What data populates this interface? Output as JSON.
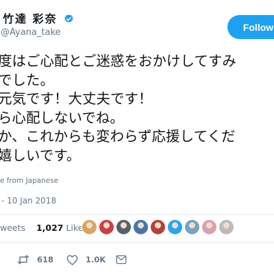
{
  "header": {
    "display_name": "竹達 彩奈",
    "handle": "@Ayana_take",
    "verified": true,
    "follow_label": "Following"
  },
  "tweet": {
    "lines": [
      "度はご心配とご迷惑をおかけしてすみ",
      "でした。",
      "元気です！大丈夫です！",
      "ら心配しないでね。",
      "か、これからも変わらず応援してくだ",
      "嬉しいです。"
    ],
    "translate_label": "e from Japanese",
    "timestamp": "- 10 Jan 2018"
  },
  "stats": {
    "retweets_label": "weets",
    "likes_count": "1,027",
    "likes_label": "Likes"
  },
  "liker_avatars": [
    {
      "name": "avatar-1",
      "color": "#d9a15b"
    },
    {
      "name": "avatar-2",
      "color": "#c8343a"
    },
    {
      "name": "avatar-3",
      "color": "#4f5961"
    },
    {
      "name": "avatar-4",
      "color": "#3c6ea8"
    },
    {
      "name": "avatar-5",
      "color": "#b13a2c"
    },
    {
      "name": "avatar-6",
      "color": "#1da1f2"
    },
    {
      "name": "avatar-7",
      "color": "#6f9fbf"
    },
    {
      "name": "avatar-8",
      "color": "#d99bb0"
    },
    {
      "name": "avatar-9",
      "color": "#b8b8b8"
    }
  ],
  "actions": {
    "reply_icon": "reply-icon",
    "retweet_icon": "retweet-icon",
    "retweet_count": "618",
    "like_icon": "heart-icon",
    "like_count": "1.0K",
    "dm_icon": "message-icon"
  },
  "colors": {
    "brand_blue": "#1da1f2",
    "text": "#14171a",
    "secondary": "#657786"
  }
}
